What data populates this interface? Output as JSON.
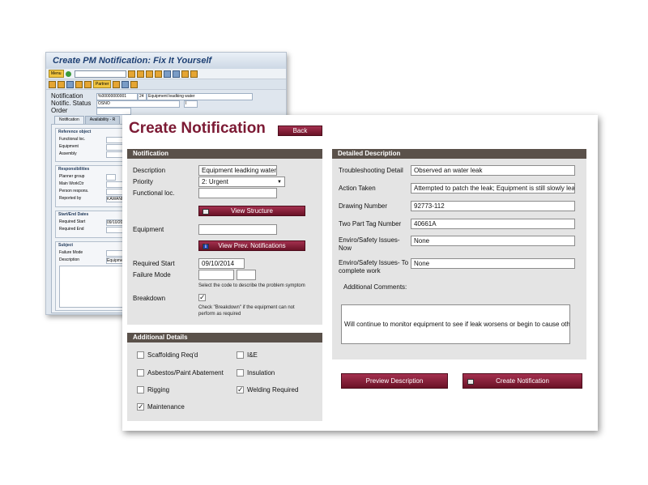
{
  "sap": {
    "title": "Create PM Notification: Fix It Yourself",
    "menu_label": "Menu",
    "partner_label": "Partner",
    "notification_label": "Notification",
    "notification_value": "%00000000001",
    "notification_type": "24",
    "notification_text": "Equipment leadking water",
    "status_label": "Notific. Status",
    "status_value": "OSNO",
    "status_extra": "I",
    "order_label": "Order",
    "tabs": [
      "Notification",
      "Availability - R"
    ],
    "groups": {
      "reference_title": "Reference object",
      "functional_loc": "Functional loc.",
      "equipment": "Equipment",
      "assembly": "Assembly",
      "responsibilities_title": "Responsibilities",
      "planner_group": "Planner group",
      "main_workctr": "Main WorkCtr",
      "person_respons": "Person respons.",
      "reported_by": "Reported by",
      "reported_by_value": "KAWANI,",
      "startend_title": "Start/End Dates",
      "required_start": "Required Start",
      "required_start_value": "09/10/20",
      "required_end": "Required End",
      "subject_title": "Subject",
      "failure_mode": "Failure Mode",
      "description": "Description",
      "description_value": "Equipment"
    }
  },
  "main": {
    "title": "Create Notification",
    "back_label": "Back",
    "notification_section": {
      "header": "Notification",
      "description_label": "Description",
      "description_value": "Equipment leadking water",
      "priority_label": "Priority",
      "priority_value": "2: Urgent",
      "functional_loc_label": "Functional loc.",
      "functional_loc_value": "",
      "view_structure_label": "View Structure",
      "equipment_label": "Equipment",
      "equipment_value": "",
      "view_prev_label": "View Prev. Notifications",
      "required_start_label": "Required Start",
      "required_start_value": "09/10/2014",
      "failure_mode_label": "Failure Mode",
      "failure_mode_note": "Select the code to describe the problem symptom",
      "breakdown_label": "Breakdown",
      "breakdown_checked": true,
      "breakdown_note_line1": "Check \"Breakdown\" if the equipment can not",
      "breakdown_note_line2": "perform as required"
    },
    "additional_section": {
      "header": "Additional Details",
      "items": [
        {
          "label": "Scaffolding Req'd",
          "checked": false
        },
        {
          "label": "I&E",
          "checked": false
        },
        {
          "label": "Asbestos/Paint Abatement",
          "checked": false
        },
        {
          "label": "Insulation",
          "checked": false
        },
        {
          "label": "Rigging",
          "checked": false
        },
        {
          "label": "Welding Required",
          "checked": true
        },
        {
          "label": "Maintenance",
          "checked": true
        }
      ]
    },
    "detailed_section": {
      "header": "Detailed Description",
      "troubleshooting_label": "Troubleshooting Detail",
      "troubleshooting_value": "Observed an water leak",
      "action_label": "Action Taken",
      "action_value": "Attempted to patch the leak; Equipment is still slowly leaking",
      "drawing_label": "Drawing Number",
      "drawing_value": "92773-112",
      "tag_label": "Two Part Tag Number",
      "tag_value": "40661A",
      "enviro_now_label_1": "Enviro/Safety Issues-",
      "enviro_now_label_2": "Now",
      "enviro_now_value": "None",
      "enviro_complete_label_1": "Enviro/Safety Issues- To",
      "enviro_complete_label_2": "complete work",
      "enviro_complete_value": "None",
      "comments_label": "Additional Comments:",
      "comments_value": "Will continue to monitor equipment to see if leak worsens or begin to cause other issues"
    },
    "preview_label": "Preview Description",
    "create_label": "Create Notification"
  },
  "colors": {
    "maroon": "#7c1a34",
    "section_header": "#5a514a",
    "section_body": "#e4e4e4"
  }
}
